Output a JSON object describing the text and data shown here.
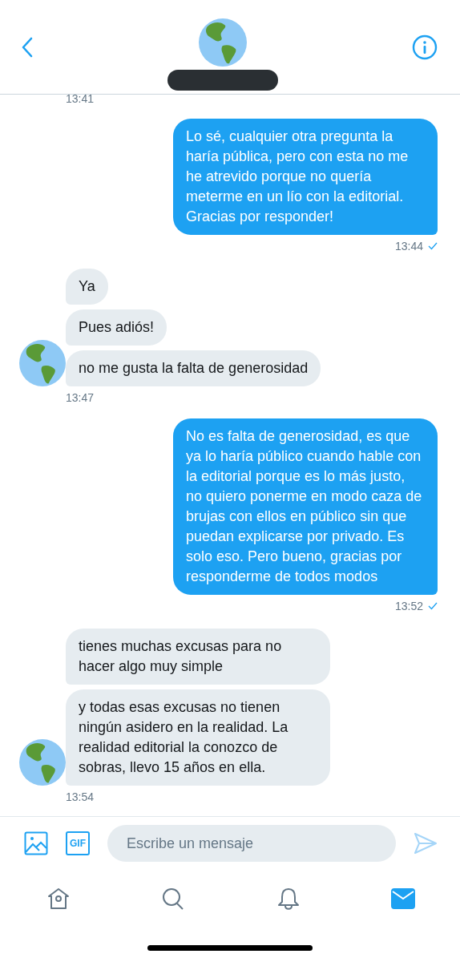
{
  "top_time": "13:41",
  "groups": [
    {
      "kind": "sent",
      "bubbles": [
        "Lo sé, cualquier otra pregunta la haría pública, pero con esta no me he atrevido porque no quería meterme en un lío con la editorial. Gracias por responder!"
      ],
      "time": "13:44",
      "read": true
    },
    {
      "kind": "received",
      "bubbles": [
        "Ya",
        "Pues adiós!",
        "no me gusta la falta de generosidad"
      ],
      "time": "13:47"
    },
    {
      "kind": "sent",
      "bubbles": [
        "No es falta de generosidad, es que ya lo haría público cuando hable con la editorial porque es lo más justo, no quiero ponerme en modo caza de brujas con ellos en público sin que puedan explicarse por privado. Es solo eso. Pero bueno, gracias por responderme de todos modos"
      ],
      "time": "13:52",
      "read": true
    },
    {
      "kind": "received",
      "bubbles": [
        "tienes muchas excusas para no hacer algo muy simple",
        "y todas esas excusas no tienen ningún asidero en la realidad. La realidad editorial la conozco de sobras, llevo 15 años en ella."
      ],
      "time": "13:54"
    }
  ],
  "composer": {
    "gif_label": "GIF",
    "placeholder": "Escribe un mensaje"
  },
  "tabs": [
    {
      "kind": "home",
      "selected": false
    },
    {
      "kind": "search",
      "selected": false
    },
    {
      "kind": "notifications",
      "selected": false
    },
    {
      "kind": "messages",
      "selected": true
    }
  ]
}
